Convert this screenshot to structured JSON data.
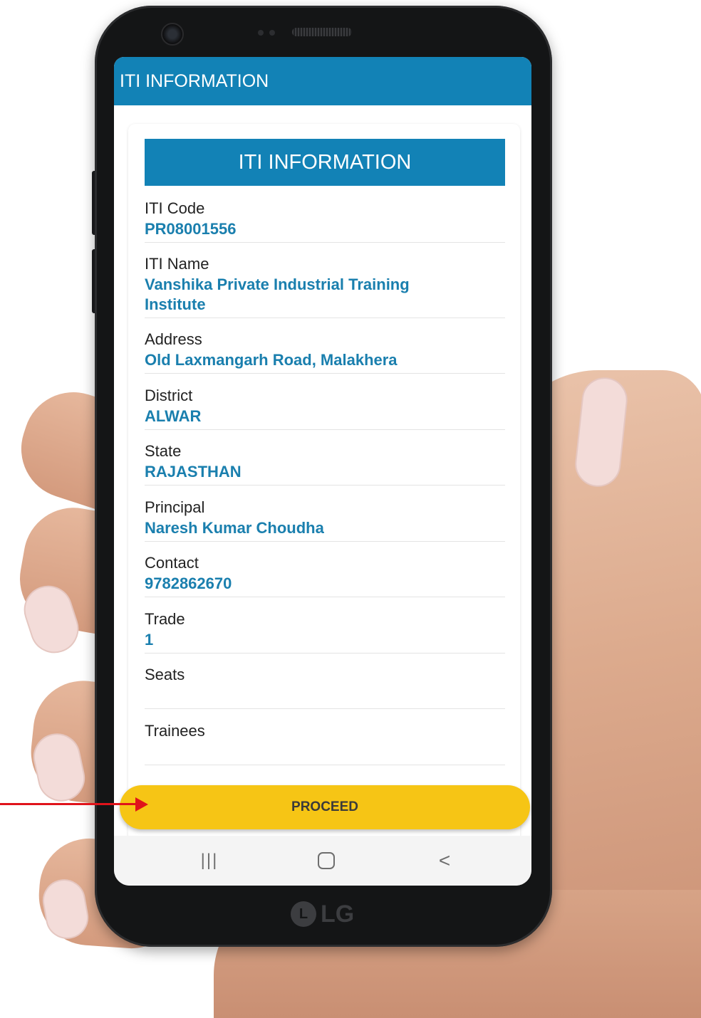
{
  "app": {
    "appbar_title": "ITI INFORMATION",
    "card_title": "ITI INFORMATION",
    "fields": [
      {
        "label": "ITI Code",
        "value": "PR08001556"
      },
      {
        "label": "ITI Name",
        "value": "Vanshika Private Industrial Training Institute"
      },
      {
        "label": "Address",
        "value": "Old Laxmangarh Road, Malakhera"
      },
      {
        "label": "District",
        "value": "ALWAR"
      },
      {
        "label": "State",
        "value": "RAJASTHAN"
      },
      {
        "label": "Principal",
        "value": "Naresh Kumar Choudha"
      },
      {
        "label": "Contact",
        "value": "9782862670"
      },
      {
        "label": "Trade",
        "value": "1"
      },
      {
        "label": "Seats",
        "value": ""
      },
      {
        "label": "Trainees",
        "value": ""
      }
    ],
    "proceed_label": "PROCEED"
  },
  "navbar": {
    "recent_glyph": "|||",
    "back_glyph": "<"
  },
  "device": {
    "brand": "LG",
    "brand_logo_glyph": "L"
  },
  "colors": {
    "primary": "#1282b6",
    "value_text": "#1a7fae",
    "proceed_button": "#f6c515",
    "annotation_arrow": "#e0131b"
  },
  "icons": [
    "recent-apps-icon",
    "home-icon",
    "back-icon",
    "annotation-arrow"
  ]
}
